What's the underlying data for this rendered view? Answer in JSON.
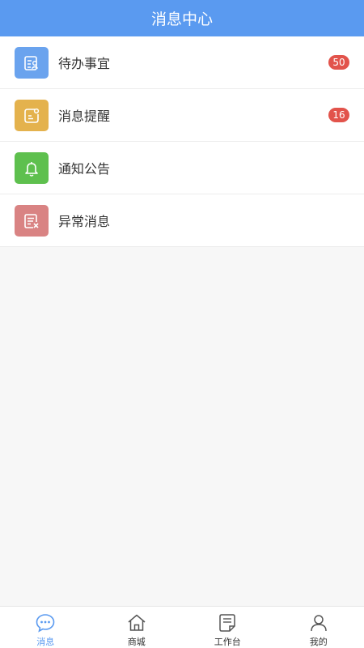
{
  "header": {
    "title": "消息中心"
  },
  "colors": {
    "accent": "#5a9af0",
    "badge": "#e2534b"
  },
  "items": [
    {
      "label": "待办事宜",
      "badge": "50",
      "icon": "todo-list-icon",
      "icon_color": "#6aa3ee"
    },
    {
      "label": "消息提醒",
      "badge": "16",
      "icon": "message-reminder-icon",
      "icon_color": "#e4b24d"
    },
    {
      "label": "通知公告",
      "badge": "",
      "icon": "bell-icon",
      "icon_color": "#5ec04e"
    },
    {
      "label": "异常消息",
      "badge": "",
      "icon": "abnormal-message-icon",
      "icon_color": "#d98383"
    }
  ],
  "tabbar": {
    "active": 0,
    "tabs": [
      {
        "label": "消息",
        "icon": "chat-bubble-icon"
      },
      {
        "label": "商城",
        "icon": "home-icon"
      },
      {
        "label": "工作台",
        "icon": "workbench-icon"
      },
      {
        "label": "我的",
        "icon": "user-icon"
      }
    ]
  }
}
